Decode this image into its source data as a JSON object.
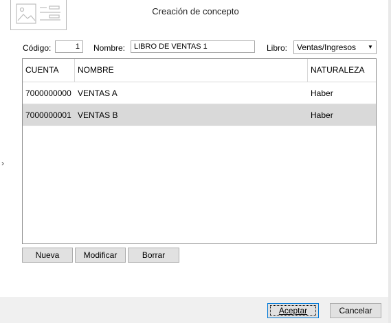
{
  "dialog": {
    "title": "Creación de concepto"
  },
  "form": {
    "codigo_label": "Código:",
    "codigo_value": "1",
    "nombre_label": "Nombre:",
    "nombre_value": "LIBRO DE VENTAS 1",
    "libro_label": "Libro:",
    "libro_value": "Ventas/Ingresos"
  },
  "grid": {
    "columns": [
      "CUENTA",
      "NOMBRE",
      "NATURALEZA"
    ],
    "rows": [
      {
        "cuenta": "7000000000",
        "nombre": "VENTAS A",
        "naturaleza": "Haber",
        "selected": false
      },
      {
        "cuenta": "7000000001",
        "nombre": "VENTAS B",
        "naturaleza": "Haber",
        "selected": true
      }
    ]
  },
  "actions": {
    "nueva": "Nueva",
    "modificar": "Modificar",
    "borrar": "Borrar"
  },
  "footer": {
    "aceptar": "Aceptar",
    "cancelar": "Cancelar"
  },
  "icons": {
    "logo": "image-placeholder-icon",
    "side": "chevron-right-icon",
    "dropdown": "chevron-down-icon"
  }
}
